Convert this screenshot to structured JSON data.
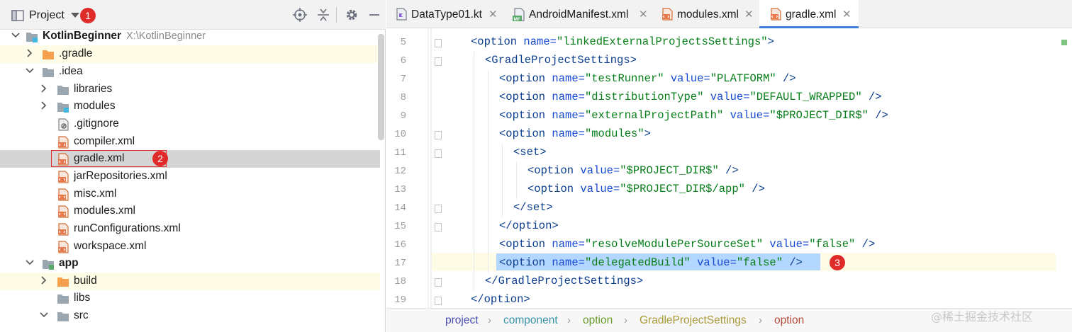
{
  "project_panel": {
    "title": "Project",
    "badge1": "1",
    "badge2": "2",
    "toolbar": [
      "locate-icon",
      "collapse-icon",
      "gear-icon",
      "minimize-icon"
    ],
    "tree": [
      {
        "label": "KotlinBeginner",
        "path": "X:\\KotlinBeginner",
        "icon": "module-folder-icon"
      },
      {
        "label": ".gradle",
        "icon": "folder-orange-icon"
      },
      {
        "label": ".idea",
        "icon": "folder-icon"
      },
      {
        "label": "libraries",
        "icon": "folder-icon"
      },
      {
        "label": "modules",
        "icon": "folder-module-icon"
      },
      {
        "label": ".gitignore",
        "icon": "gitignore-file-icon"
      },
      {
        "label": "compiler.xml",
        "icon": "xml-file-icon"
      },
      {
        "label": "gradle.xml",
        "icon": "xml-file-icon"
      },
      {
        "label": "jarRepositories.xml",
        "icon": "xml-file-icon"
      },
      {
        "label": "misc.xml",
        "icon": "xml-file-icon"
      },
      {
        "label": "modules.xml",
        "icon": "xml-file-icon"
      },
      {
        "label": "runConfigurations.xml",
        "icon": "xml-file-icon"
      },
      {
        "label": "workspace.xml",
        "icon": "xml-file-icon"
      },
      {
        "label": "app",
        "icon": "module-folder-icon"
      },
      {
        "label": "build",
        "icon": "folder-orange-icon"
      },
      {
        "label": "libs",
        "icon": "folder-icon"
      },
      {
        "label": "src",
        "icon": "folder-icon"
      }
    ]
  },
  "tabs": [
    {
      "label": "DataType01.kt",
      "icon": "kotlin-file-icon"
    },
    {
      "label": "AndroidManifest.xml",
      "icon": "manifest-file-icon"
    },
    {
      "label": "modules.xml",
      "icon": "xml-file-icon"
    },
    {
      "label": "gradle.xml",
      "icon": "xml-file-icon"
    }
  ],
  "editor": {
    "lines": [
      {
        "n": "5",
        "parts": [
          [
            "tg",
            "<option "
          ],
          [
            "an",
            "name="
          ],
          [
            "av",
            "\"linkedExternalProjectsSettings\""
          ],
          [
            "tg",
            ">"
          ]
        ]
      },
      {
        "n": "6",
        "parts": [
          [
            "tg",
            "<GradleProjectSettings>"
          ]
        ]
      },
      {
        "n": "7",
        "parts": [
          [
            "tg",
            "<option "
          ],
          [
            "an",
            "name="
          ],
          [
            "av",
            "\"testRunner\""
          ],
          [
            "pn",
            " "
          ],
          [
            "an",
            "value="
          ],
          [
            "av",
            "\"PLATFORM\""
          ],
          [
            "tg",
            " />"
          ]
        ]
      },
      {
        "n": "8",
        "parts": [
          [
            "tg",
            "<option "
          ],
          [
            "an",
            "name="
          ],
          [
            "av",
            "\"distributionType\""
          ],
          [
            "pn",
            " "
          ],
          [
            "an",
            "value="
          ],
          [
            "av",
            "\"DEFAULT_WRAPPED\""
          ],
          [
            "tg",
            " />"
          ]
        ]
      },
      {
        "n": "9",
        "parts": [
          [
            "tg",
            "<option "
          ],
          [
            "an",
            "name="
          ],
          [
            "av",
            "\"externalProjectPath\""
          ],
          [
            "pn",
            " "
          ],
          [
            "an",
            "value="
          ],
          [
            "av",
            "\"$PROJECT_DIR$\""
          ],
          [
            "tg",
            " />"
          ]
        ]
      },
      {
        "n": "10",
        "parts": [
          [
            "tg",
            "<option "
          ],
          [
            "an",
            "name="
          ],
          [
            "av",
            "\"modules\""
          ],
          [
            "tg",
            ">"
          ]
        ]
      },
      {
        "n": "11",
        "parts": [
          [
            "tg",
            "<set>"
          ]
        ]
      },
      {
        "n": "12",
        "parts": [
          [
            "tg",
            "<option "
          ],
          [
            "an",
            "value="
          ],
          [
            "av",
            "\"$PROJECT_DIR$\""
          ],
          [
            "tg",
            " />"
          ]
        ]
      },
      {
        "n": "13",
        "parts": [
          [
            "tg",
            "<option "
          ],
          [
            "an",
            "value="
          ],
          [
            "av",
            "\"$PROJECT_DIR$/app\""
          ],
          [
            "tg",
            " />"
          ]
        ]
      },
      {
        "n": "14",
        "parts": [
          [
            "tg",
            "</set>"
          ]
        ]
      },
      {
        "n": "15",
        "parts": [
          [
            "tg",
            "</option>"
          ]
        ]
      },
      {
        "n": "16",
        "parts": [
          [
            "tg",
            "<option "
          ],
          [
            "an",
            "name="
          ],
          [
            "av",
            "\"resolveModulePerSourceSet\""
          ],
          [
            "pn",
            " "
          ],
          [
            "an",
            "value="
          ],
          [
            "av",
            "\"false\""
          ],
          [
            "tg",
            " />"
          ]
        ]
      },
      {
        "n": "17",
        "parts": [
          [
            "tg",
            "<option "
          ],
          [
            "an",
            "name="
          ],
          [
            "av",
            "\"delegatedBuild\""
          ],
          [
            "pn",
            " "
          ],
          [
            "an",
            "value="
          ],
          [
            "av",
            "\"false\""
          ],
          [
            "tg",
            " />"
          ]
        ]
      },
      {
        "n": "18",
        "parts": [
          [
            "tg",
            "</GradleProjectSettings>"
          ]
        ]
      },
      {
        "n": "19",
        "parts": [
          [
            "tg",
            "</option>"
          ]
        ]
      }
    ],
    "badge3": "3"
  },
  "breadcrumb": [
    {
      "label": "project",
      "color": "#4a4fb0"
    },
    {
      "label": "component",
      "color": "#3a93a6"
    },
    {
      "label": "option",
      "color": "#6c9a2c"
    },
    {
      "label": "GradleProjectSettings",
      "color": "#a99a3a"
    },
    {
      "label": "option",
      "color": "#b24a3a"
    }
  ],
  "watermark": "@稀土掘金技术社区",
  "colors": {
    "selection": "#b3d7ff",
    "current_line": "#fefbe6",
    "selected_row": "#d5d5d5",
    "badge": "#e02b2b"
  }
}
